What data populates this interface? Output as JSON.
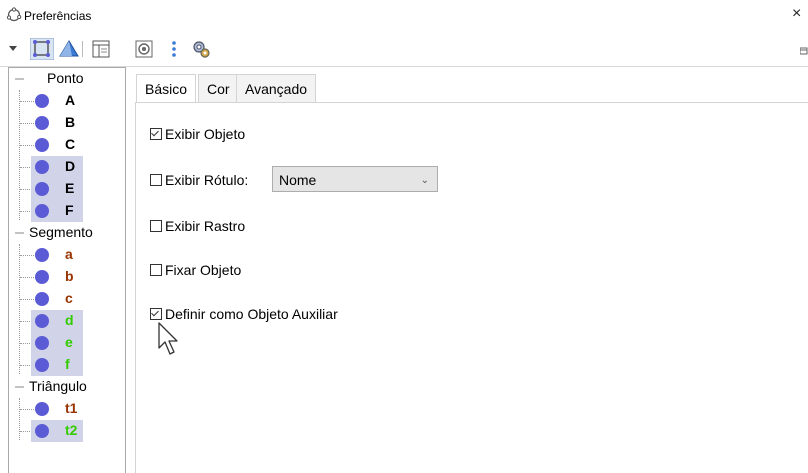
{
  "window": {
    "title": "Preferências",
    "close_glyph": "×"
  },
  "toolbar": {
    "icons": [
      "dropdown-arrow-icon",
      "graphics-icon",
      "graphics-3d-icon",
      "layout-icon",
      "defaults-icon",
      "more-icon",
      "settings-icon"
    ]
  },
  "tree": {
    "categories": [
      {
        "label": "Ponto",
        "items": [
          {
            "name": "A",
            "color": "#000000",
            "selected": false
          },
          {
            "name": "B",
            "color": "#000000",
            "selected": false
          },
          {
            "name": "C",
            "color": "#000000",
            "selected": false
          },
          {
            "name": "D",
            "color": "#000000",
            "selected": true
          },
          {
            "name": "E",
            "color": "#000000",
            "selected": true
          },
          {
            "name": "F",
            "color": "#000000",
            "selected": true
          }
        ]
      },
      {
        "label": "Segmento",
        "items": [
          {
            "name": "a",
            "color": "#993300",
            "selected": false
          },
          {
            "name": "b",
            "color": "#993300",
            "selected": false
          },
          {
            "name": "c",
            "color": "#993300",
            "selected": false
          },
          {
            "name": "d",
            "color": "#33cc00",
            "selected": true
          },
          {
            "name": "e",
            "color": "#33cc00",
            "selected": true
          },
          {
            "name": "f",
            "color": "#33cc00",
            "selected": true
          }
        ]
      },
      {
        "label": "Triângulo",
        "items": [
          {
            "name": "t1",
            "color": "#993300",
            "selected": false
          },
          {
            "name": "t2",
            "color": "#33cc00",
            "selected": true
          }
        ]
      }
    ],
    "point_color": "#5b5bd6"
  },
  "tabs": [
    {
      "label": "Básico",
      "active": true
    },
    {
      "label": "Cor",
      "active": false
    },
    {
      "label": "Avançado",
      "active": false
    }
  ],
  "options": {
    "show_object": {
      "label": "Exibir Objeto",
      "checked": true
    },
    "show_label": {
      "label": "Exibir Rótulo:",
      "checked": false
    },
    "label_select": {
      "value": "Nome"
    },
    "show_trace": {
      "label": "Exibir Rastro",
      "checked": false
    },
    "fix_object": {
      "label": "Fixar Objeto",
      "checked": false
    },
    "auxiliary": {
      "label": "Definir como Objeto Auxiliar",
      "checked": true
    }
  }
}
